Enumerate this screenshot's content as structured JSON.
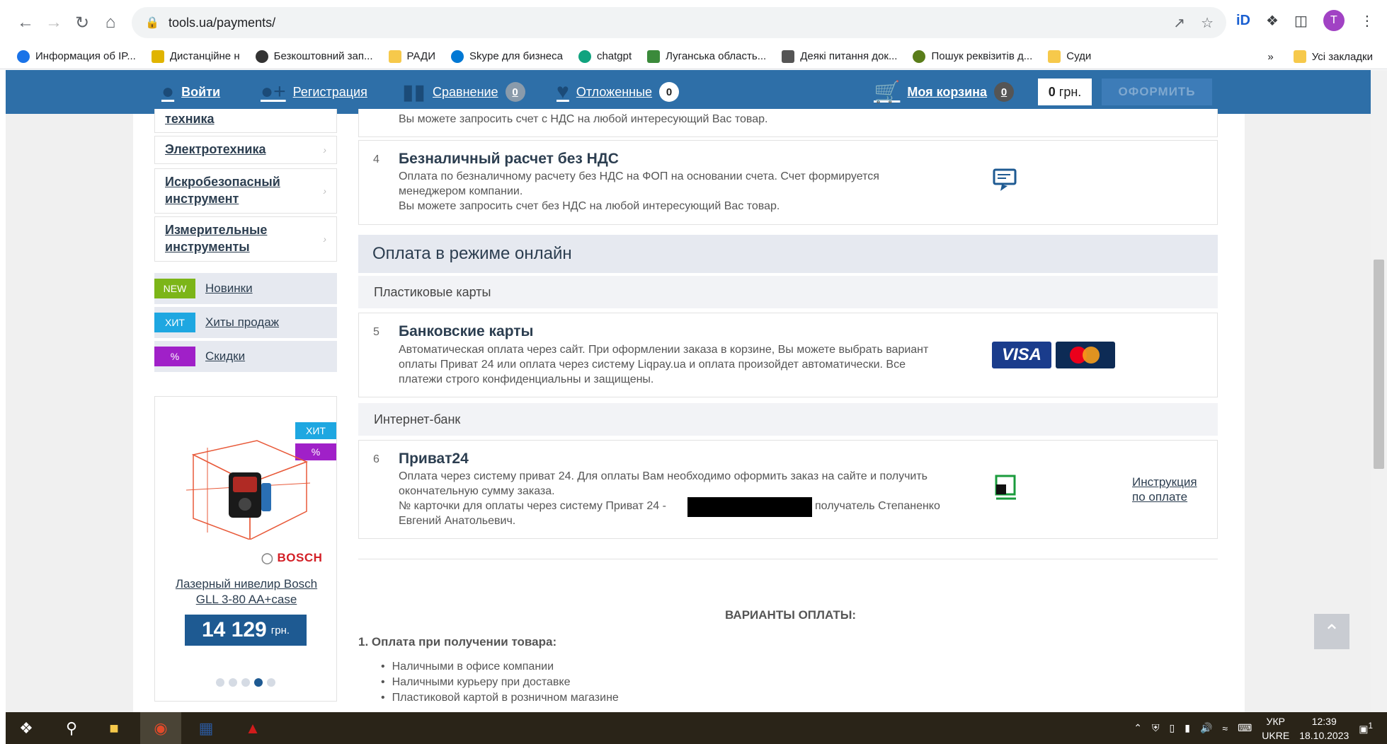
{
  "browser": {
    "url": "tools.ua/payments/",
    "avatar_letter": "T",
    "bookmarks": [
      {
        "label": "Информация об IP...",
        "color": "#1a73e8"
      },
      {
        "label": "Дистанційне н",
        "color": "#e0b400"
      },
      {
        "label": "Безкоштовний зап...",
        "color": "#333333"
      },
      {
        "label": "РАДИ",
        "color": "#f6c94b"
      },
      {
        "label": "Skype для бизнеса",
        "color": "#0078d4"
      },
      {
        "label": "chatgpt",
        "color": "#10a37f"
      },
      {
        "label": "Луганська область...",
        "color": "#3b8a3b"
      },
      {
        "label": "Деякі питання док...",
        "color": "#555555"
      },
      {
        "label": "Пошук реквізитів д...",
        "color": "#5a7d1a"
      },
      {
        "label": "Суди",
        "color": "#f6c94b"
      }
    ],
    "bookmarks_more": "»",
    "all_bookmarks": "Усі закладки"
  },
  "header": {
    "login": "Войти",
    "register": "Регистрация",
    "compare": "Сравнение",
    "compare_count": "0",
    "saved": "Отложенные",
    "saved_count": "0",
    "cart": "Моя корзина",
    "cart_count": "0",
    "cart_sum_value": "0",
    "cart_sum_currency": "грн.",
    "order_button": "ОФОРМИТЬ"
  },
  "sidebar": {
    "categories": [
      {
        "label": "техника"
      },
      {
        "label": "Электротехника"
      },
      {
        "label": "Искробезопасный инструмент"
      },
      {
        "label": "Измерительные инструменты"
      }
    ],
    "tags": [
      {
        "badge": "NEW",
        "label": "Новинки",
        "color": "#7cb518"
      },
      {
        "badge": "ХИТ",
        "label": "Хиты продаж",
        "color": "#1ea7e1"
      },
      {
        "badge": "%",
        "label": "Скидки",
        "color": "#a020c8"
      }
    ],
    "promo": {
      "badge_hit": "ХИТ",
      "badge_sale": "%",
      "brand": "BOSCH",
      "title": "Лазерный нивелир Bosch GLL 3-80 AA+case",
      "price": "14 129",
      "currency": "грн."
    }
  },
  "content": {
    "item_top": {
      "text": "Вы можете запросить счет с НДС на любой интересующий Вас товар."
    },
    "item4": {
      "num": "4",
      "title": "Безналичный расчет без НДС",
      "line1": "Оплата по безналичному расчету без НДС на ФОП на основании счета. Счет формируется",
      "line2": "менеджером компании.",
      "line3": "Вы можете запросить счет без НДС на любой интересующий Вас товар."
    },
    "online_heading": "Оплата в режиме онлайн",
    "cards_heading": "Пластиковые карты",
    "item5": {
      "num": "5",
      "title": "Банковские карты",
      "line1": "Автоматическая оплата через сайт. При оформлении заказа в корзине, Вы можете выбрать вариант",
      "line2": "оплаты Приват 24 или оплата через систему Liqpay.ua и оплата произойдет автоматически. Все",
      "line3": "платежи строго конфиденциальны и защищены.",
      "visa": "VISA"
    },
    "bank_heading": "Интернет-банк",
    "item6": {
      "num": "6",
      "title": "Приват24",
      "line1": "Оплата через систему приват 24. Для оплаты Вам необходимо оформить заказ на сайте и получить",
      "line2": "окончательную сумму заказа.",
      "line3a": "№ карточки для оплаты через систему Приват 24 -",
      "line3b": "получатель Степаненко",
      "line4": "Евгений Анатольевич.",
      "instruction": "Инструкция по оплате"
    },
    "variants_title": "ВАРИАНТЫ ОПЛАТЫ:",
    "variants_sub": "1. Оплата при получении товара:",
    "variants": [
      "Наличными в офисе компании",
      "Наличными курьеру при доставке",
      "Пластиковой картой в розничном магазине"
    ]
  },
  "taskbar": {
    "lang": "УКР",
    "lang2": "UKRE",
    "time": "12:39",
    "date": "18.10.2023",
    "notifications": "1"
  }
}
